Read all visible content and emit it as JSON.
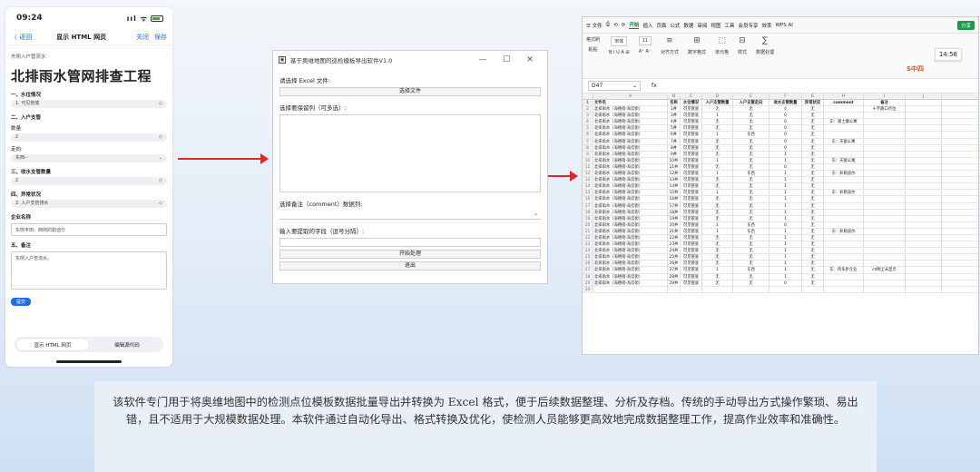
{
  "phone": {
    "time": "09:24",
    "signal": "ııl ᯤ",
    "nav": {
      "back": "〈 返回",
      "title": "显示 HTML 网页",
      "close": "关闭",
      "save": "保存"
    },
    "subtitle": "东侧入户管流水",
    "heading": "北排雨水管网排查工程",
    "sections": [
      {
        "title": "一、水位情况",
        "select": "1. 可见管底"
      },
      {
        "title": "二、入户支管",
        "label": "数量:",
        "select": "2",
        "label2": "走向:",
        "select2": "东西--"
      },
      {
        "title": "三、收水支管数量",
        "select": "2"
      },
      {
        "title": "四、异常状况",
        "select": "2. 入户支管排水"
      }
    ],
    "company_label": "企业名称",
    "company_value": "东侧丰田、西侧的勒迪尔",
    "remark_label": "五、备注",
    "remark_value": "东侧入户管流水。",
    "submit": "提交",
    "tabs": [
      "显示 HTML 网页",
      "编辑源代码"
    ]
  },
  "dialog": {
    "title": "基于奥维地图的巡检模板导出软件V1.0",
    "win_controls": [
      "—",
      "☐",
      "✕"
    ],
    "select_file_label": "请选择 Excel 文件:",
    "select_file_btn": "选择文件",
    "keep_cols_label": "选择要保留列（可多选）:",
    "comment_label": "选择备注（comment）数据列:",
    "fields_label": "输入要提取的字段（逗号分隔）:",
    "start_btn": "开始处理",
    "exit_btn": "退出"
  },
  "spreadsheet": {
    "menu": [
      "☰ 文件",
      "⎙",
      "⟲",
      "⟳",
      "开始",
      "插入",
      "页面",
      "公式",
      "数据",
      "审阅",
      "视图",
      "工具",
      "会员专享",
      "效率",
      "WPS AI"
    ],
    "active_menu": "开始",
    "share": "分享",
    "ribbon": [
      {
        "top": "格式刷",
        "bottom": "粘贴"
      },
      {
        "top": "宋体",
        "bottom": "B  I  U  A  ⊞"
      },
      {
        "top": "11",
        "bottom": "A⁺ A⁻"
      },
      {
        "top": "≡",
        "bottom": "对齐方式"
      },
      {
        "top": "⊞",
        "bottom": "数字格式"
      },
      {
        "top": "⬚",
        "bottom": "单元格"
      },
      {
        "top": "⊟",
        "bottom": "样式"
      },
      {
        "top": "∑",
        "bottom": "数据处理"
      }
    ],
    "time_tooltip": "14:58",
    "logo": "S中四",
    "cell_ref": "D47",
    "fx": "fx",
    "columns": [
      "A",
      "B",
      "C",
      "D",
      "E",
      "F",
      "G",
      "H",
      "I",
      "J"
    ],
    "header_row": [
      "文件名",
      "名称",
      "水位情况",
      "入户支管数量",
      "入户支管走向",
      "收水支管数量",
      "异常状况",
      "comment",
      "备注",
      ""
    ],
    "rows": [
      [
        "北排雨水（海德街-海云街）",
        "1井",
        "可见管底",
        "无",
        "无",
        "4",
        "无",
        "",
        "十字路口点位",
        ""
      ],
      [
        "北排雨水（海德街-海云街）",
        "3井",
        "可见管底",
        "1",
        "无",
        "0",
        "无",
        "",
        "",
        ""
      ],
      [
        "北排雨水（海德街-海云街）",
        "4井",
        "可见管底",
        "无",
        "无",
        "0",
        "无",
        "东：富士康公寓",
        "",
        ""
      ],
      [
        "北排雨水（海德街-海云街）",
        "5井",
        "可见管底",
        "无",
        "无",
        "0",
        "无",
        "",
        "",
        ""
      ],
      [
        "北排雨水（海德街-海云街）",
        "6井",
        "可见管底",
        "1",
        "东西",
        "0",
        "无",
        "",
        "",
        ""
      ],
      [
        "北排雨水（海德街-海云街）",
        "7井",
        "可见管底",
        "无",
        "无",
        "0",
        "无",
        "东：天富公寓",
        "",
        ""
      ],
      [
        "北排雨水（海德街-海云街）",
        "8井",
        "可见管底",
        "无",
        "无",
        "0",
        "无",
        "",
        "",
        ""
      ],
      [
        "北排雨水（海德街-海云街）",
        "9井",
        "可见管底",
        "无",
        "无",
        "1",
        "无",
        "",
        "",
        ""
      ],
      [
        "北排雨水（海德街-海云街）",
        "10井",
        "可见管底",
        "1",
        "无",
        "1",
        "无",
        "东：天富公寓",
        "",
        ""
      ],
      [
        "北排雨水（海德街-海云街）",
        "11井",
        "可见管底",
        "无",
        "无",
        "0",
        "无",
        "",
        "",
        ""
      ],
      [
        "北排雨水（海德街-海云街）",
        "12井",
        "可见管底",
        "1",
        "东西",
        "1",
        "无",
        "东：扒勒迪尔",
        "",
        ""
      ],
      [
        "北排雨水（海德街-海云街）",
        "13井",
        "可见管底",
        "无",
        "无",
        "1",
        "无",
        "",
        "",
        ""
      ],
      [
        "北排雨水（海德街-海云街）",
        "14井",
        "可见管底",
        "无",
        "无",
        "1",
        "无",
        "",
        "",
        ""
      ],
      [
        "北排雨水（海德街-海云街）",
        "15井",
        "可见管底",
        "1",
        "无",
        "1",
        "无",
        "东：扒勒迪尔",
        "",
        ""
      ],
      [
        "北排雨水（海德街-海云街）",
        "16井",
        "可见管底",
        "无",
        "无",
        "1",
        "无",
        "",
        "",
        ""
      ],
      [
        "北排雨水（海德街-海云街）",
        "17井",
        "可见管底",
        "无",
        "无",
        "1",
        "无",
        "",
        "",
        ""
      ],
      [
        "北排雨水（海德街-海云街）",
        "18井",
        "可见管底",
        "无",
        "无",
        "1",
        "无",
        "",
        "",
        ""
      ],
      [
        "北排雨水（海德街-海云街）",
        "19井",
        "可见管底",
        "无",
        "无",
        "1",
        "无",
        "",
        "",
        ""
      ],
      [
        "北排雨水（海德街-海云街）",
        "20井",
        "可见管底",
        "1",
        "东西",
        "0",
        "无",
        "",
        "",
        ""
      ],
      [
        "北排雨水（海德街-海云街）",
        "21井",
        "可见管底",
        "1",
        "东西",
        "1",
        "无",
        "东：扒勒迪尔",
        "",
        ""
      ],
      [
        "北排雨水（海德街-海云街）",
        "22井",
        "可见管底",
        "无",
        "无",
        "1",
        "无",
        "",
        "",
        ""
      ],
      [
        "北排雨水（海德街-海云街）",
        "23井",
        "可见管底",
        "无",
        "无",
        "1",
        "无",
        "",
        "",
        ""
      ],
      [
        "北排雨水（海德街-海云街）",
        "24井",
        "可见管底",
        "无",
        "无",
        "1",
        "无",
        "",
        "",
        ""
      ],
      [
        "北排雨水（海德街-海云街）",
        "25井",
        "可见管底",
        "无",
        "无",
        "1",
        "无",
        "",
        "",
        ""
      ],
      [
        "北排雨水（海德街-海云街）",
        "26井",
        "可见管底",
        "无",
        "无",
        "1",
        "无",
        "",
        "",
        ""
      ],
      [
        "北排雨水（海德街-海云街）",
        "27井",
        "可见管底",
        "1",
        "东西",
        "1",
        "无",
        "东：所乐步企业",
        "cd侧上未显示",
        ""
      ],
      [
        "北排雨水（海德街-海云街）",
        "28井",
        "可见管底",
        "无",
        "无",
        "1",
        "无",
        "",
        "",
        ""
      ],
      [
        "北排雨水（海德街-海云街）",
        "29井",
        "可见管底",
        "无",
        "无",
        "0",
        "无",
        "",
        "",
        ""
      ],
      [
        "",
        "",
        "",
        "",
        "",
        "",
        "",
        "",
        "",
        ""
      ]
    ]
  },
  "description": "该软件专门用于将奥维地图中的检测点位模板数据批量导出并转换为 Excel 格式，便于后续数据整理、分析及存档。传统的手动导出方式操作繁琐、易出错，且不适用于大规模数据处理。本软件通过自动化导出、格式转换及优化，使检测人员能够更高效地完成数据整理工作，提高作业效率和准确性。",
  "colors": {
    "arrow": "#e3262b",
    "accent": "#1f6fe0",
    "wps_green": "#1a7f3b"
  }
}
